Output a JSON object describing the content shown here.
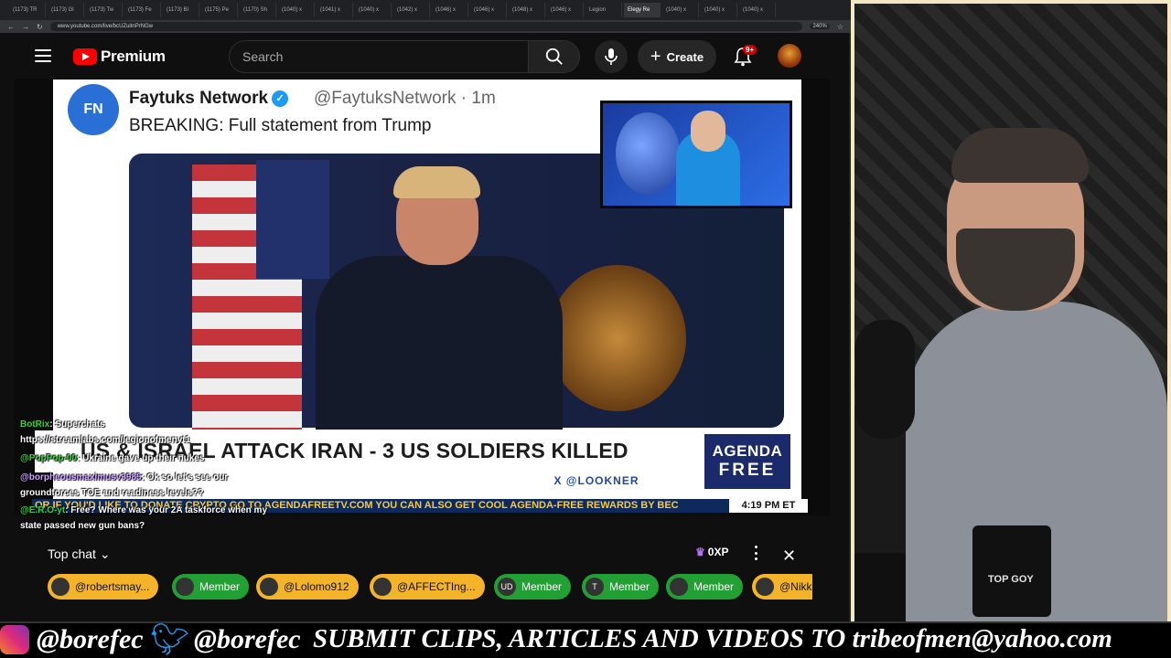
{
  "browser": {
    "tabs": [
      "(1173) TR",
      "(1173) Gl",
      "(1173) Tw",
      "(1173) Fe",
      "(1173) Bl",
      "(1175) Pe",
      "(1170) Sh",
      "(1040) x",
      "(1041) x",
      "(1040) x",
      "(1042) x",
      "(1046) x",
      "(1046) x",
      "(1048) x",
      "(1046) x",
      "Legion",
      "Elegy Re",
      "(1040) x",
      "(1040) x",
      "(1040) x"
    ],
    "url": "www.youtube.com/live/bcUZuitnPrNGw",
    "zoom": "240%"
  },
  "youtube": {
    "logo_text": "Premium",
    "search_placeholder": "Search",
    "create_label": "Create",
    "notif_badge": "9+"
  },
  "tweet": {
    "avatar_text": "FN",
    "name": "Faytuks Network",
    "handle": "@FaytuksNetwork · 1m",
    "text": "BREAKING: Full statement from Trump"
  },
  "overlay": {
    "headline": "US & ISRAEL ATTACK IRAN - 3 US SOLDIERS KILLED",
    "looker": "X @LOOKNER",
    "agenda_top": "AGENDA",
    "agenda_bottom": "FREE",
    "ticker": "OR IF YOU'D LIKE TO DONATE CRYPTO GO TO AGENDAFREETV.COM     YOU CAN ALSO GET COOL AGENDA-FREE REWARDS BY BEC",
    "time": "4:19 PM ET"
  },
  "stream_chat": [
    {
      "user": "BotRix",
      "msg": ": Superchats"
    },
    {
      "user": "",
      "msg": "https://streamlabs.com/legionofmenyt1"
    },
    {
      "user": "@PopPop-00",
      "msg": ": Ukraine gave up their nukes"
    },
    {
      "user": "@borpheousmaximusv3985",
      "msg": ": Ok so let's see our"
    },
    {
      "user": "",
      "msg": "groundforces TOE and readiness levels??"
    },
    {
      "user": "@E.R.O-yt",
      "msg": ": Free? Where was your 2A taskforce when my"
    },
    {
      "user": "",
      "msg": "state passed new gun bans?"
    }
  ],
  "ytchat": {
    "mode": "Top chat",
    "xp": "0XP",
    "pills": [
      {
        "label": "@robertsmay...",
        "style": "gold",
        "av": ""
      },
      {
        "label": "Member",
        "style": "green",
        "av": ""
      },
      {
        "label": "@Lolomo912",
        "style": "gold",
        "av": ""
      },
      {
        "label": "@AFFECTIng...",
        "style": "gold",
        "av": ""
      },
      {
        "label": "Member",
        "style": "green",
        "av": "UD"
      },
      {
        "label": "Member",
        "style": "green",
        "av": "T"
      },
      {
        "label": "Member",
        "style": "green",
        "av": ""
      },
      {
        "label": "@Nikki",
        "style": "gold",
        "av": ""
      }
    ]
  },
  "webcam": {
    "mug_text": "TOP GOY"
  },
  "banner": {
    "ig_handle": "@borefec",
    "tw_handle": "@borefec",
    "submit": "SUBMIT CLIPS, ARTICLES AND VIDEOS TO tribeofmen@yahoo.com"
  },
  "colors": {
    "youtube_red": "#ff0000",
    "gold_pill": "#f3b429",
    "member_green": "#22a033",
    "ticker_yellow": "#f6c945"
  }
}
